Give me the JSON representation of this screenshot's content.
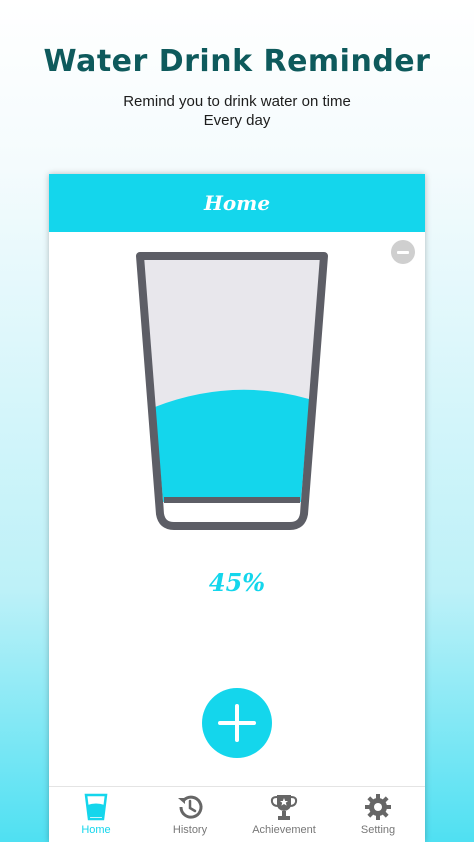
{
  "promo": {
    "title": "Water Drink Reminder",
    "subtitle_line1": "Remind you to drink water on time",
    "subtitle_line2": "Every day"
  },
  "appbar": {
    "title": "Home"
  },
  "glass": {
    "fill_percent": 45
  },
  "progress": {
    "percent_label": "45%"
  },
  "nav": [
    {
      "label": "Home",
      "icon": "glass-icon",
      "active": true
    },
    {
      "label": "History",
      "icon": "history-icon",
      "active": false
    },
    {
      "label": "Achievement",
      "icon": "trophy-icon",
      "active": false
    },
    {
      "label": "Setting",
      "icon": "gear-icon",
      "active": false
    }
  ],
  "colors": {
    "accent": "#14d6ec",
    "glass_outline": "#5d5e66",
    "glass_inner": "#e8e7ec",
    "inactive_nav": "#777777"
  }
}
